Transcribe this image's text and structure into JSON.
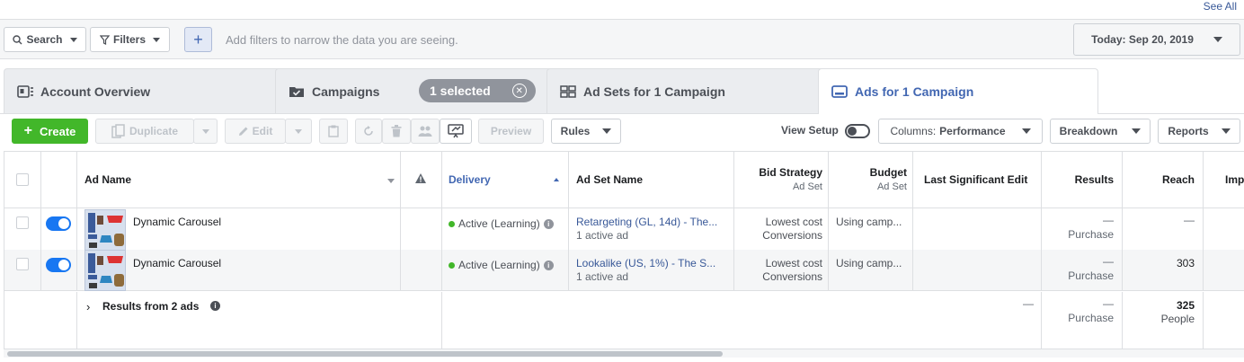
{
  "header": {
    "see_all": "See All"
  },
  "filterbar": {
    "search_label": "Search",
    "filters_label": "Filters",
    "add_label": "+",
    "hint": "Add filters to narrow the data you are seeing.",
    "date_label": "Today: Sep 20, 2019"
  },
  "tabs": [
    {
      "label": "Account Overview",
      "icon": "overview-icon"
    },
    {
      "label": "Campaigns",
      "icon": "folder-check-icon",
      "badge": "1 selected"
    },
    {
      "label": "Ad Sets for 1 Campaign",
      "icon": "adsets-icon"
    },
    {
      "label": "Ads for 1 Campaign",
      "icon": "ad-icon",
      "active": true
    }
  ],
  "toolbar": {
    "create": "Create",
    "duplicate": "Duplicate",
    "edit": "Edit",
    "preview": "Preview",
    "rules": "Rules",
    "view_setup": "View Setup",
    "columns_prefix": "Columns:",
    "columns_value": "Performance",
    "breakdown": "Breakdown",
    "reports": "Reports"
  },
  "table": {
    "columns": {
      "ad_name": "Ad Name",
      "delivery": "Delivery",
      "ad_set_name": "Ad Set Name",
      "bid_strategy": "Bid Strategy",
      "bid_strategy_sub": "Ad Set",
      "budget": "Budget",
      "budget_sub": "Ad Set",
      "last_edit": "Last Significant Edit",
      "results": "Results",
      "reach": "Reach",
      "impressions": "Imp"
    },
    "rows": [
      {
        "ad_name": "Dynamic Carousel",
        "delivery": "Active (Learning)",
        "ad_set": "Retargeting (GL, 14d) - The...",
        "ad_set_sub": "1 active ad",
        "bid": "Lowest cost",
        "bid_sub": "Conversions",
        "budget": "Using camp...",
        "results": "—",
        "results_sub": "Purchase",
        "reach": "—"
      },
      {
        "ad_name": "Dynamic Carousel",
        "delivery": "Active (Learning)",
        "ad_set": "Lookalike (US, 1%) - The S...",
        "ad_set_sub": "1 active ad",
        "bid": "Lowest cost",
        "bid_sub": "Conversions",
        "budget": "Using camp...",
        "results": "—",
        "results_sub": "Purchase",
        "reach": "303"
      }
    ],
    "summary": {
      "label": "Results from 2 ads",
      "last_edit": "—",
      "results": "—",
      "results_sub": "Purchase",
      "reach": "325",
      "reach_sub": "People"
    }
  },
  "colors": {
    "accent": "#4267b2",
    "create": "#42b72a",
    "link": "#385898",
    "toggle_on": "#1877f2"
  }
}
